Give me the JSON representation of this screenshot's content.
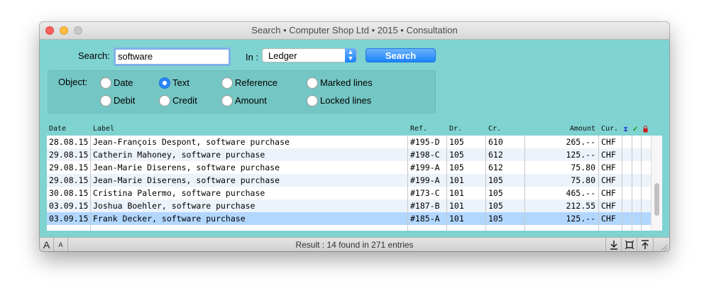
{
  "window": {
    "title": "Search • Computer Shop Ltd • 2015 • Consultation"
  },
  "search": {
    "label": "Search:",
    "value": "software",
    "in_label": "In :",
    "in_value": "Ledger",
    "button": "Search"
  },
  "object": {
    "label": "Object:",
    "options": [
      {
        "label": "Date",
        "selected": false
      },
      {
        "label": "Text",
        "selected": true
      },
      {
        "label": "Reference",
        "selected": false
      },
      {
        "label": "Marked lines",
        "selected": false
      },
      {
        "label": "Debit",
        "selected": false
      },
      {
        "label": "Credit",
        "selected": false
      },
      {
        "label": "Amount",
        "selected": false
      },
      {
        "label": "Locked lines",
        "selected": false
      }
    ]
  },
  "table": {
    "headers": {
      "date": "Date",
      "label": "Label",
      "ref": "Ref.",
      "dr": "Dr.",
      "cr": "Cr.",
      "amount": "Amount",
      "cur": "Cur."
    },
    "header_icons": {
      "attach": "paperclip-icon",
      "check": "checkmark-icon",
      "lock": "lock-icon"
    },
    "rows": [
      {
        "date": "28.08.15",
        "label": "Jean-François Despont, software purchase",
        "ref": "#195-D",
        "dr": "105",
        "cr": "610",
        "amount": "265.--",
        "cur": "CHF"
      },
      {
        "date": "29.08.15",
        "label": "Catherin Mahoney, software purchase",
        "ref": "#198-C",
        "dr": "105",
        "cr": "612",
        "amount": "125.--",
        "cur": "CHF"
      },
      {
        "date": "29.08.15",
        "label": "Jean-Marie Diserens, software purchase",
        "ref": "#199-A",
        "dr": "105",
        "cr": "612",
        "amount": "75.80",
        "cur": "CHF"
      },
      {
        "date": "29.08.15",
        "label": "Jean-Marie Diserens, software purchase",
        "ref": "#199-A",
        "dr": "101",
        "cr": "105",
        "amount": "75.80",
        "cur": "CHF"
      },
      {
        "date": "30.08.15",
        "label": "Cristina Palermo, software purchase",
        "ref": "#173-C",
        "dr": "101",
        "cr": "105",
        "amount": "465.--",
        "cur": "CHF"
      },
      {
        "date": "03.09.15",
        "label": "Joshua Boehler, software purchase",
        "ref": "#187-B",
        "dr": "101",
        "cr": "105",
        "amount": "212.55",
        "cur": "CHF"
      },
      {
        "date": "03.09.15",
        "label": "Frank Decker, software purchase",
        "ref": "#185-A",
        "dr": "101",
        "cr": "105",
        "amount": "125.--",
        "cur": "CHF"
      }
    ],
    "selected_index": 6
  },
  "status": {
    "text": "Result : 14 found in 271 entries",
    "font_large": "A",
    "font_small": "A"
  },
  "colors": {
    "window_bg": "#7fd3d1",
    "accent": "#1a82fb",
    "selected_row": "#b2d7ff"
  }
}
